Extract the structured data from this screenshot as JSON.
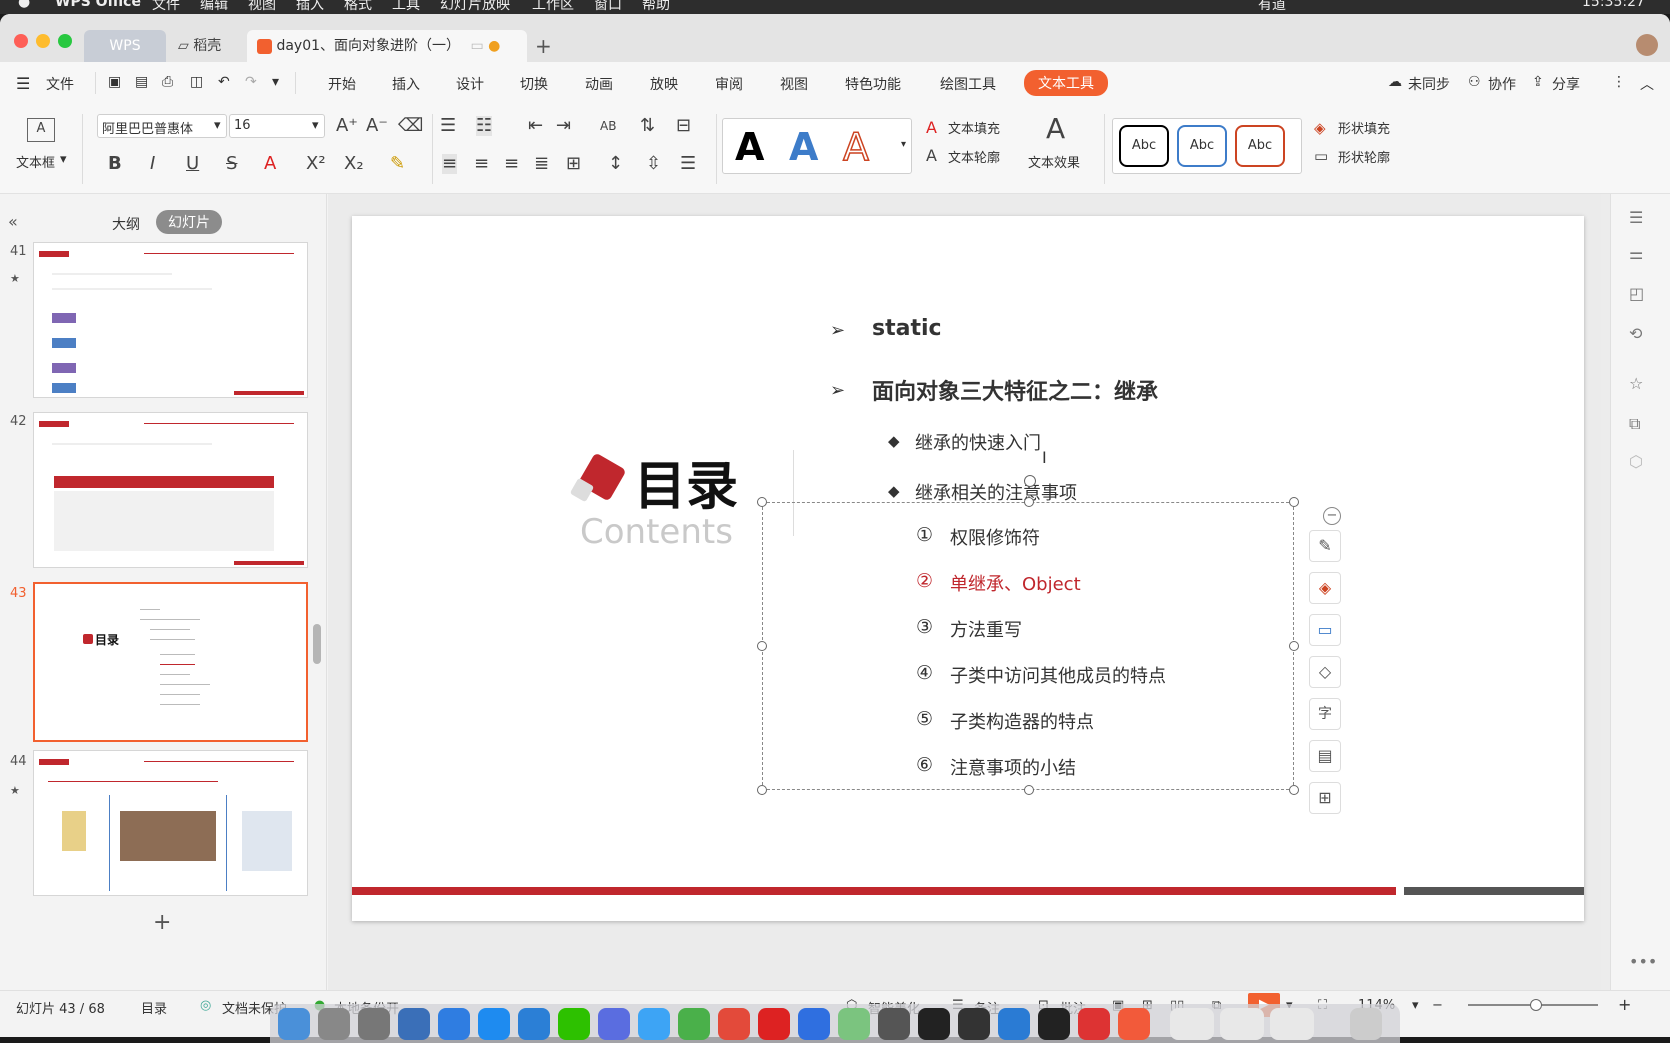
{
  "mac_menubar": {
    "app": "WPS Office",
    "items": [
      "文件",
      "编辑",
      "视图",
      "插入",
      "格式",
      "工具",
      "幻灯片放映",
      "工作区",
      "窗口",
      "帮助"
    ],
    "right_items": [
      "有道"
    ],
    "clock": "15:35:27"
  },
  "tabs": [
    {
      "label": "WPS"
    },
    {
      "label": "稻壳"
    },
    {
      "label": "day01、面向对象进阶（一）"
    }
  ],
  "new_tab": "+",
  "menu": {
    "file_label": "文件",
    "tabs": [
      "开始",
      "插入",
      "设计",
      "切换",
      "动画",
      "放映",
      "审阅",
      "视图",
      "特色功能",
      "绘图工具",
      "文本工具"
    ],
    "active_tab": "文本工具",
    "sync": "未同步",
    "collab": "协作",
    "share": "分享"
  },
  "ribbon": {
    "textbox_label": "文本框",
    "font_name": "阿里巴巴普惠体",
    "font_size": "16",
    "art_letters": [
      "A",
      "A",
      "A"
    ],
    "text_fill": "文本填充",
    "text_outline": "文本轮廓",
    "text_effect": "文本效果",
    "abc": [
      "Abc",
      "Abc",
      "Abc"
    ],
    "shape_fill": "形状填充",
    "shape_outline": "形状轮廓"
  },
  "panel": {
    "outline_tab": "大纲",
    "slides_tab": "幻灯片",
    "add": "+"
  },
  "thumbnails": [
    {
      "num": "41"
    },
    {
      "num": "42"
    },
    {
      "num": "43"
    },
    {
      "num": "44"
    }
  ],
  "slide": {
    "title": "目录",
    "subtitle": "Contents",
    "items": [
      {
        "marker": "➢",
        "text": "static"
      },
      {
        "marker": "➢",
        "text": "面向对象三大特征之二：继承"
      }
    ],
    "sub_items": [
      {
        "marker": "◆",
        "text": "继承的快速入门"
      },
      {
        "marker": "◆",
        "text": "继承相关的注意事项"
      }
    ],
    "numbered": [
      {
        "num": "①",
        "text": "权限修饰符",
        "highlight": false
      },
      {
        "num": "②",
        "text": "单继承、Object",
        "highlight": true
      },
      {
        "num": "③",
        "text": "方法重写",
        "highlight": false
      },
      {
        "num": "④",
        "text": "子类中访问其他成员的特点",
        "highlight": false
      },
      {
        "num": "⑤",
        "text": "子类构造器的特点",
        "highlight": false
      },
      {
        "num": "⑥",
        "text": "注意事项的小结",
        "highlight": false
      }
    ],
    "colors": {
      "red": "#c0272d",
      "text": "#333333",
      "gray": "#cccccc"
    }
  },
  "status": {
    "slide_counter": "幻灯片 43 / 68",
    "section": "目录",
    "protect": "文档未保护",
    "backup": "本地备份开",
    "beautify": "智能美化",
    "notes": "备注",
    "comments": "批注",
    "zoom": "114%"
  },
  "accent": "#f2602f"
}
